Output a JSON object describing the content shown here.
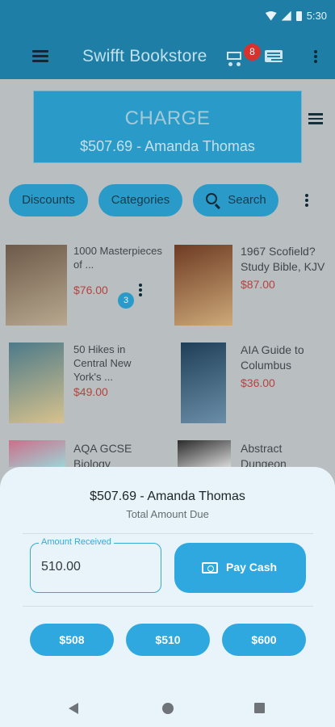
{
  "status_bar": {
    "time": "5:30"
  },
  "app_bar": {
    "title": "Swifft Bookstore",
    "cart_count": "8"
  },
  "charge": {
    "label": "CHARGE",
    "summary": "$507.69 - Amanda Thomas"
  },
  "filters": {
    "discounts": "Discounts",
    "categories": "Categories",
    "search": "Search"
  },
  "products": [
    {
      "title": "1000 Masterpieces of ...",
      "price": "$76.00",
      "cover_colors": [
        "#6d5a49",
        "#b8a88f"
      ],
      "quantity": "3"
    },
    {
      "title": "1967 Scofield? Study Bible, KJV",
      "price": "$87.00",
      "cover_colors": [
        "#6e3b23",
        "#cda979"
      ]
    },
    {
      "title": "50 Hikes in Central New York's ...",
      "price": "$49.00",
      "cover_colors": [
        "#4d7a8a",
        "#d7c28c"
      ]
    },
    {
      "title": "AIA Guide to Columbus",
      "price": "$36.00",
      "cover_colors": [
        "#1f3f57",
        "#6b8ea8"
      ]
    },
    {
      "title": "AQA GCSE Biology",
      "price": "",
      "cover_colors": [
        "#cc6f8a",
        "#9ed3d7"
      ]
    },
    {
      "title": "Abstract Dungeon",
      "price": "",
      "cover_colors": [
        "#2b2b2b",
        "#d8d8d8"
      ]
    }
  ],
  "sheet": {
    "amount_line": "$507.69 - Amanda Thomas",
    "caption": "Total Amount Due",
    "amount_label": "Amount Received",
    "amount_value": "510.00",
    "pay_label": "Pay Cash",
    "quick_amounts": [
      "$508",
      "$510",
      "$600"
    ]
  },
  "colors": {
    "primary": "#2fa8df",
    "price": "#d9312b"
  }
}
